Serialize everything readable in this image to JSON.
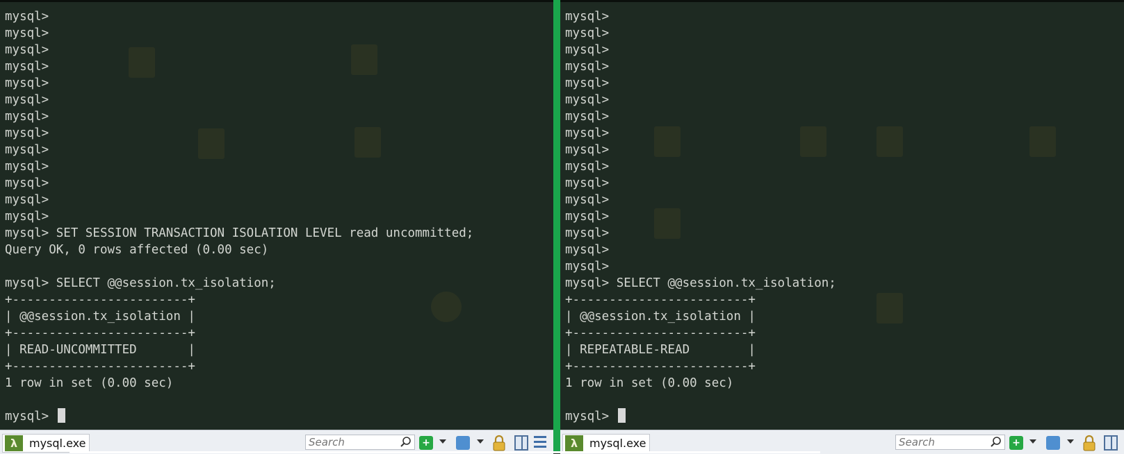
{
  "left": {
    "lines": [
      "mysql>",
      "mysql>",
      "mysql>",
      "mysql>",
      "mysql>",
      "mysql>",
      "mysql>",
      "mysql>",
      "mysql>",
      "mysql>",
      "mysql>",
      "mysql>",
      "mysql>",
      "mysql> SET SESSION TRANSACTION ISOLATION LEVEL read uncommitted;",
      "Query OK, 0 rows affected (0.00 sec)",
      "",
      "mysql> SELECT @@session.tx_isolation;",
      "+------------------------+",
      "| @@session.tx_isolation |",
      "+------------------------+",
      "| READ-UNCOMMITTED       |",
      "+------------------------+",
      "1 row in set (0.00 sec)",
      ""
    ],
    "prompt": "mysql> ",
    "tab_label": "mysql.exe",
    "search_placeholder": "Search"
  },
  "right": {
    "lines": [
      "mysql>",
      "mysql>",
      "mysql>",
      "mysql>",
      "mysql>",
      "mysql>",
      "mysql>",
      "mysql>",
      "mysql>",
      "mysql>",
      "mysql>",
      "mysql>",
      "mysql>",
      "mysql>",
      "mysql>",
      "mysql>",
      "mysql> SELECT @@session.tx_isolation;",
      "+------------------------+",
      "| @@session.tx_isolation |",
      "+------------------------+",
      "| REPEATABLE-READ        |",
      "+------------------------+",
      "1 row in set (0.00 sec)",
      ""
    ],
    "prompt": "mysql> ",
    "tab_label": "mysql.exe",
    "search_placeholder": "Search"
  },
  "toolbar": {
    "tab_icon": "λ",
    "add_glyph": "+"
  },
  "colors": {
    "terminal_bg": "#1e2a22",
    "terminal_fg": "#d3d6d1",
    "divider": "#1aa64c"
  },
  "icons": [
    "lambda-icon",
    "search-icon",
    "plus-icon",
    "chevron-down-icon",
    "tile-icon",
    "lock-icon",
    "split-view-icon",
    "menu-icon"
  ]
}
